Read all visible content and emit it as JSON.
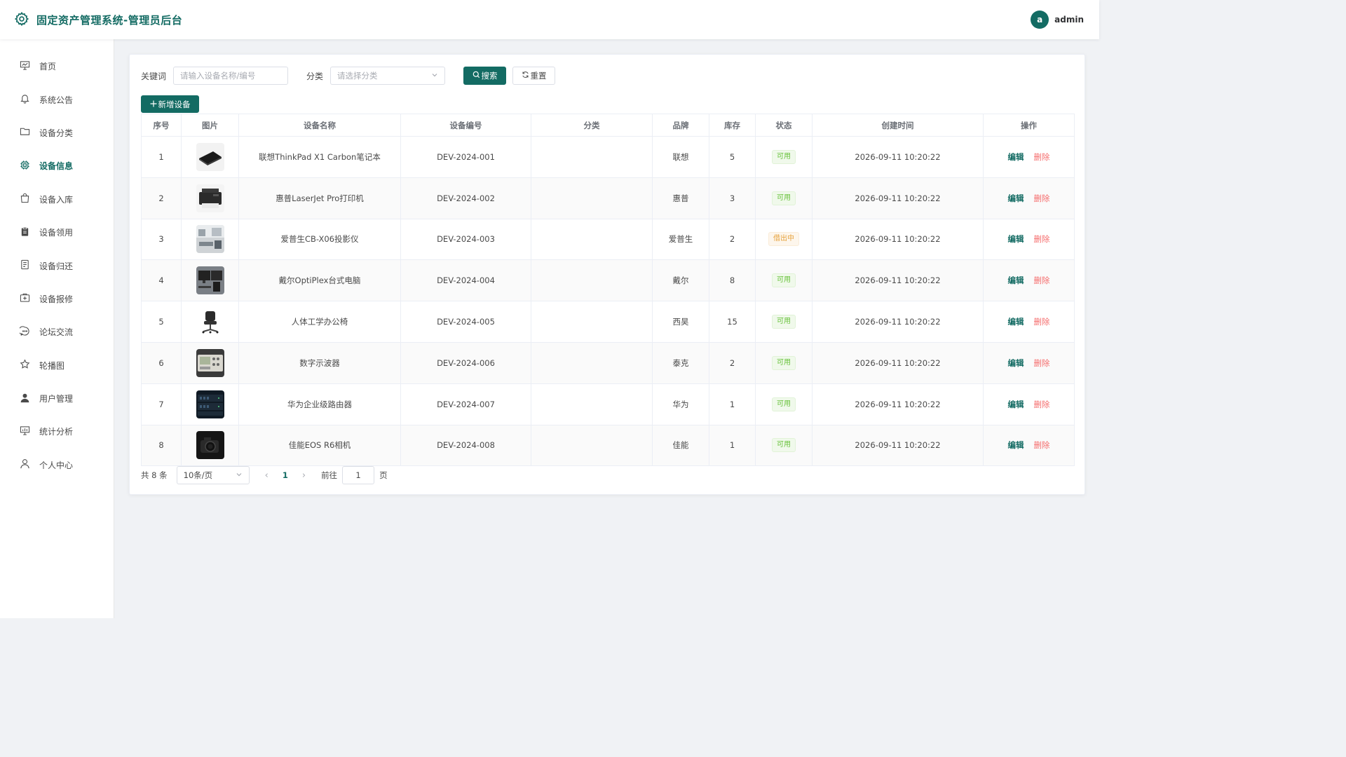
{
  "header": {
    "title": "固定资产管理系统-管理员后台",
    "username": "admin",
    "avatar_letter": "a",
    "icon": "gear-icon"
  },
  "sidebar": {
    "items": [
      {
        "label": "首页",
        "icon": "presentation-board-icon",
        "active": false
      },
      {
        "label": "系统公告",
        "icon": "bell-icon",
        "active": false
      },
      {
        "label": "设备分类",
        "icon": "folder-icon",
        "active": false
      },
      {
        "label": "设备信息",
        "icon": "chip-icon",
        "active": true
      },
      {
        "label": "设备入库",
        "icon": "shopping-bag-icon",
        "active": false
      },
      {
        "label": "设备领用",
        "icon": "clipboard-icon",
        "active": false
      },
      {
        "label": "设备归还",
        "icon": "document-icon",
        "active": false
      },
      {
        "label": "设备报修",
        "icon": "first-aid-kit-icon",
        "active": false
      },
      {
        "label": "论坛交流",
        "icon": "chat-bubble-icon",
        "active": false
      },
      {
        "label": "轮播图",
        "icon": "star-icon",
        "active": false
      },
      {
        "label": "用户管理",
        "icon": "user-filled-icon",
        "active": false
      },
      {
        "label": "统计分析",
        "icon": "chart-board-icon",
        "active": false
      },
      {
        "label": "个人中心",
        "icon": "user-outline-icon",
        "active": false
      }
    ]
  },
  "search": {
    "keyword_label": "关键词",
    "keyword_placeholder": "请输入设备名称/编号",
    "category_label": "分类",
    "category_placeholder": "请选择分类",
    "search_button": "搜索",
    "reset_button": "重置"
  },
  "toolbar": {
    "add_button": "新增设备"
  },
  "table": {
    "columns": [
      "序号",
      "图片",
      "设备名称",
      "设备编号",
      "分类",
      "品牌",
      "库存",
      "状态",
      "创建时间",
      "操作"
    ],
    "edit_label": "编辑",
    "delete_label": "删除",
    "rows": [
      {
        "index": "1",
        "name": "联想ThinkPad X1 Carbon笔记本",
        "code": "DEV-2024-001",
        "category": "",
        "brand": "联想",
        "stock": "5",
        "status": "可用",
        "status_type": "ok",
        "created": "2026-09-11 10:20:22",
        "thumb": "laptop"
      },
      {
        "index": "2",
        "name": "惠普LaserJet Pro打印机",
        "code": "DEV-2024-002",
        "category": "",
        "brand": "惠普",
        "stock": "3",
        "status": "可用",
        "status_type": "ok",
        "created": "2026-09-11 10:20:22",
        "thumb": "printer"
      },
      {
        "index": "3",
        "name": "爱普生CB-X06投影仪",
        "code": "DEV-2024-003",
        "category": "",
        "brand": "爱普生",
        "stock": "2",
        "status": "借出中",
        "status_type": "warn",
        "created": "2026-09-11 10:20:22",
        "thumb": "office-room"
      },
      {
        "index": "4",
        "name": "戴尔OptiPlex台式电脑",
        "code": "DEV-2024-004",
        "category": "",
        "brand": "戴尔",
        "stock": "8",
        "status": "可用",
        "status_type": "ok",
        "created": "2026-09-11 10:20:22",
        "thumb": "desktop"
      },
      {
        "index": "5",
        "name": "人体工学办公椅",
        "code": "DEV-2024-005",
        "category": "",
        "brand": "西昊",
        "stock": "15",
        "status": "可用",
        "status_type": "ok",
        "created": "2026-09-11 10:20:22",
        "thumb": "chair"
      },
      {
        "index": "6",
        "name": "数字示波器",
        "code": "DEV-2024-006",
        "category": "",
        "brand": "泰克",
        "stock": "2",
        "status": "可用",
        "status_type": "ok",
        "created": "2026-09-11 10:20:22",
        "thumb": "oscilloscope"
      },
      {
        "index": "7",
        "name": "华为企业级路由器",
        "code": "DEV-2024-007",
        "category": "",
        "brand": "华为",
        "stock": "1",
        "status": "可用",
        "status_type": "ok",
        "created": "2026-09-11 10:20:22",
        "thumb": "router"
      },
      {
        "index": "8",
        "name": "佳能EOS R6相机",
        "code": "DEV-2024-008",
        "category": "",
        "brand": "佳能",
        "stock": "1",
        "status": "可用",
        "status_type": "ok",
        "created": "2026-09-11 10:20:22",
        "thumb": "camera"
      }
    ]
  },
  "pagination": {
    "total_text": "共 8 条",
    "page_size": "10条/页",
    "current_page": "1",
    "goto_label": "前往",
    "goto_value": "1",
    "page_unit": "页"
  },
  "colors": {
    "primary": "#136b63",
    "danger": "#f56c6c",
    "success": "#67c23a",
    "warning": "#e6a23c"
  }
}
